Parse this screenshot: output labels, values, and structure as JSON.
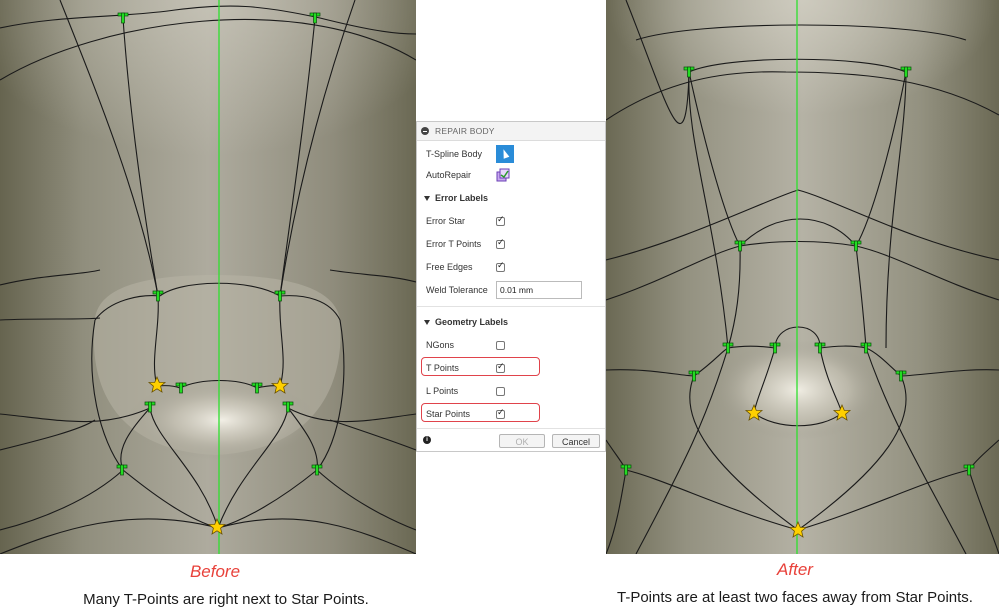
{
  "before": {
    "title": "Before",
    "caption": "Many T-Points are right next to Star Points."
  },
  "after": {
    "title": "After",
    "caption": "T-Points are at least two faces away from Star Points."
  },
  "dialog": {
    "title": "REPAIR BODY",
    "tspline_body_label": "T-Spline Body",
    "autorepair_label": "AutoRepair",
    "error_labels_section": "Error Labels",
    "error_star_label": "Error Star",
    "error_star_checked": true,
    "error_tpoints_label": "Error T Points",
    "error_tpoints_checked": true,
    "free_edges_label": "Free Edges",
    "free_edges_checked": true,
    "weld_tolerance_label": "Weld Tolerance",
    "weld_tolerance_value": "0.01 mm",
    "geometry_labels_section": "Geometry Labels",
    "ngons_label": "NGons",
    "ngons_checked": false,
    "tpoints_label": "T Points",
    "tpoints_checked": true,
    "lpoints_label": "L Points",
    "lpoints_checked": false,
    "starpoints_label": "Star Points",
    "starpoints_checked": true,
    "ok_label": "OK",
    "cancel_label": "Cancel"
  },
  "colors": {
    "accent": "#2a8cd8",
    "highlight": "#e0434b",
    "caption_title": "#e8413a",
    "tpoint": "#22dd22",
    "star": "#ffd000",
    "centerline": "#2ee02e"
  }
}
